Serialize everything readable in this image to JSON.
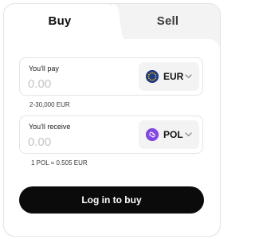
{
  "tabs": {
    "buy": "Buy",
    "sell": "Sell",
    "active": "buy"
  },
  "pay": {
    "label": "You'll pay",
    "placeholder": "0.00",
    "currency": "EUR",
    "currency_icon": "euro-stars-icon",
    "range": "2-30,000 EUR"
  },
  "receive": {
    "label": "You'll receive",
    "placeholder": "0.00",
    "currency": "POL",
    "currency_icon": "polygon-icon",
    "rate": "1 POL = 0.505 EUR"
  },
  "cta": {
    "label": "Log in to buy"
  },
  "colors": {
    "eur_icon_bg": "#1f3a8a",
    "pol_icon_bg": "#8247e5",
    "cta_bg": "#0b0b0b"
  }
}
